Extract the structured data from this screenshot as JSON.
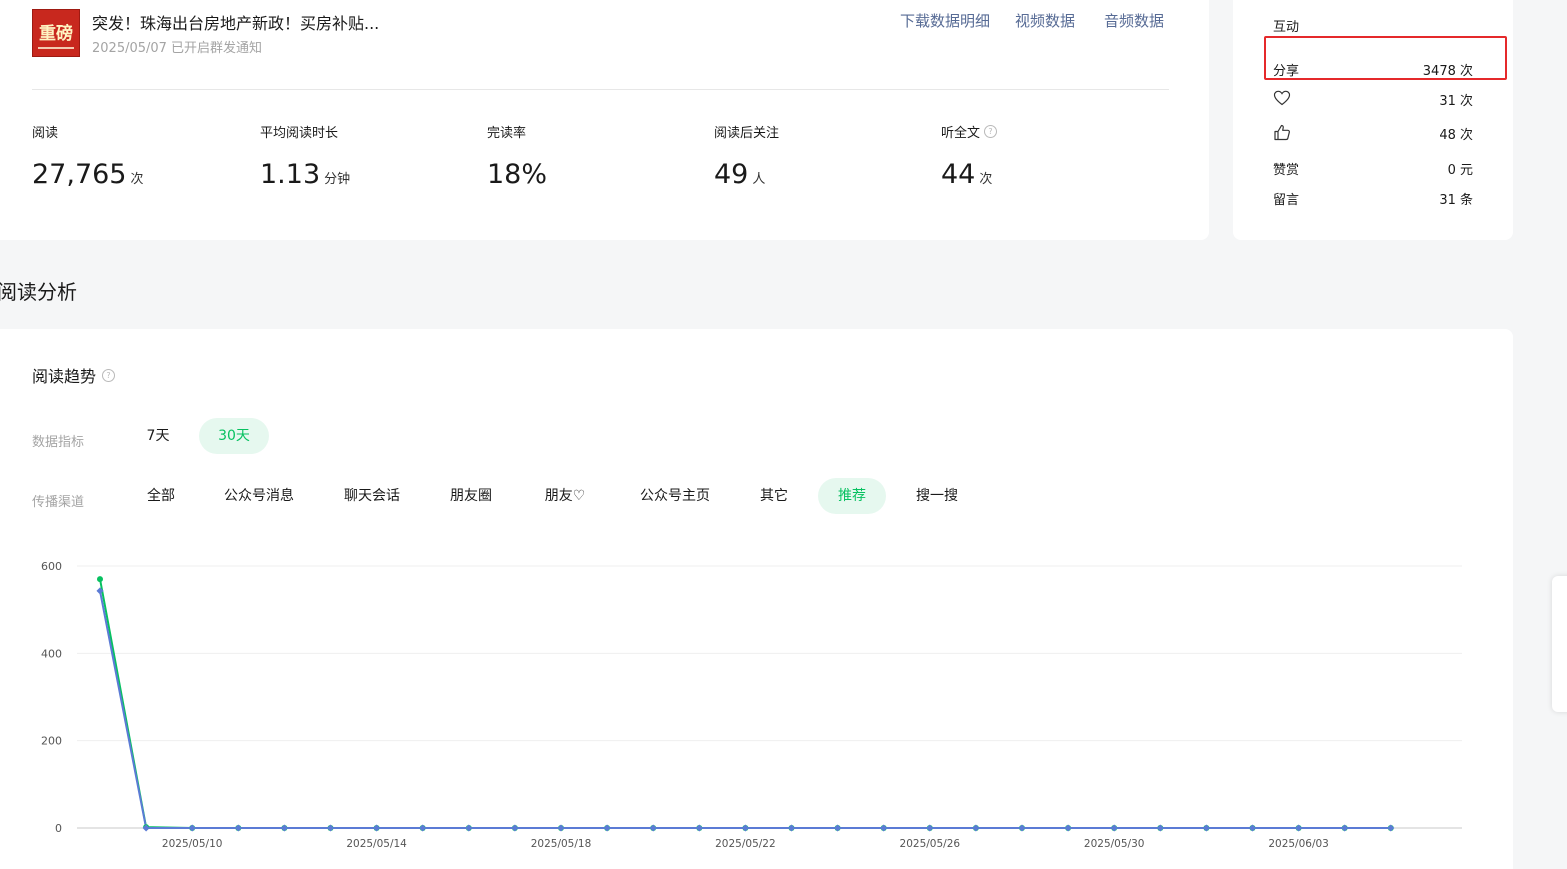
{
  "article": {
    "thumb_text": "重磅",
    "title": "突发！珠海出台房地产新政！买房补贴...",
    "meta": "2025/05/07 已开启群发通知",
    "links": [
      "下载数据明细",
      "视频数据",
      "音频数据"
    ],
    "metrics": [
      {
        "label": "阅读",
        "value": "27,765",
        "unit": "次"
      },
      {
        "label": "平均阅读时长",
        "value": "1.13",
        "unit": "分钟"
      },
      {
        "label": "完读率",
        "value": "18%",
        "unit": ""
      },
      {
        "label": "阅读后关注",
        "value": "49",
        "unit": "人"
      },
      {
        "label": "听全文",
        "value": "44",
        "unit": "次"
      }
    ]
  },
  "interaction": {
    "title": "互动",
    "rows": [
      {
        "label": "分享",
        "icon": "",
        "value": "3478 次"
      },
      {
        "label": "",
        "icon": "heart-icon",
        "value": "31 次"
      },
      {
        "label": "",
        "icon": "thumbs-up-icon",
        "value": "48 次"
      },
      {
        "label": "赞赏",
        "icon": "",
        "value": "0 元"
      },
      {
        "label": "留言",
        "icon": "",
        "value": "31 条"
      }
    ],
    "highlight_color": "#e5292b"
  },
  "section": {
    "title": "阅读分析"
  },
  "trend": {
    "title": "阅读趋势",
    "metric_label": "数据指标",
    "ranges": [
      "7天",
      "30天"
    ],
    "active_range": "30天",
    "channel_label": "传播渠道",
    "channels": [
      "全部",
      "公众号消息",
      "聊天会话",
      "朋友圈",
      "朋友♡",
      "公众号主页",
      "其它",
      "推荐",
      "搜一搜"
    ],
    "active_channel": "推荐",
    "accent_color": "#07c160"
  },
  "chart_data": {
    "type": "line",
    "y_ticks": [
      0,
      200,
      400,
      600
    ],
    "ylim": [
      0,
      600
    ],
    "x_tick_labels": [
      "2025/05/10",
      "2025/05/14",
      "2025/05/18",
      "2025/05/22",
      "2025/05/26",
      "2025/05/30",
      "2025/06/03"
    ],
    "x": [
      "2025/05/08",
      "2025/05/09",
      "2025/05/10",
      "2025/05/11",
      "2025/05/12",
      "2025/05/13",
      "2025/05/14",
      "2025/05/15",
      "2025/05/16",
      "2025/05/17",
      "2025/05/18",
      "2025/05/19",
      "2025/05/20",
      "2025/05/21",
      "2025/05/22",
      "2025/05/23",
      "2025/05/24",
      "2025/05/25",
      "2025/05/26",
      "2025/05/27",
      "2025/05/28",
      "2025/05/29",
      "2025/05/30",
      "2025/05/31",
      "2025/06/01",
      "2025/06/02",
      "2025/06/03",
      "2025/06/04",
      "2025/06/05"
    ],
    "series": [
      {
        "color": "#07c160",
        "values": [
          570,
          2,
          0,
          0,
          0,
          0,
          0,
          0,
          0,
          0,
          0,
          0,
          0,
          0,
          0,
          0,
          0,
          0,
          0,
          0,
          0,
          0,
          0,
          0,
          0,
          0,
          0,
          0,
          0
        ]
      },
      {
        "color": "#5b7bd5",
        "values": [
          543,
          0,
          0,
          0,
          0,
          0,
          0,
          0,
          0,
          0,
          0,
          0,
          0,
          0,
          0,
          0,
          0,
          0,
          0,
          0,
          0,
          0,
          0,
          0,
          0,
          0,
          0,
          0,
          0
        ]
      }
    ],
    "grid": true
  }
}
